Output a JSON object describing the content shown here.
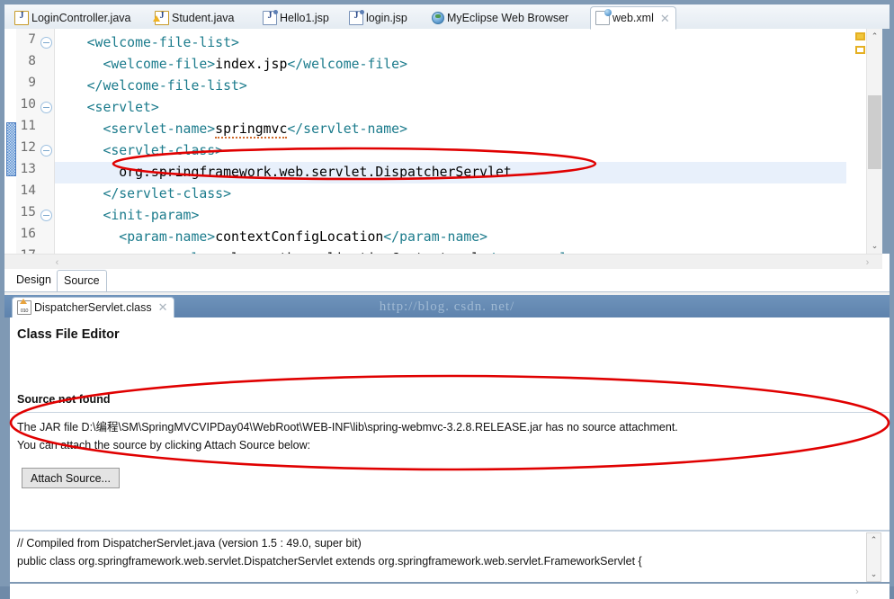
{
  "editor_tabs": [
    {
      "label": "LoginController.java",
      "icon": "java-file-icon",
      "active": false,
      "closable": false
    },
    {
      "label": "Student.java",
      "icon": "java-file-warning-icon",
      "active": false,
      "closable": false
    },
    {
      "label": "Hello1.jsp",
      "icon": "jsp-file-icon",
      "active": false,
      "closable": false
    },
    {
      "label": "login.jsp",
      "icon": "jsp-file-icon",
      "active": false,
      "closable": false
    },
    {
      "label": "MyEclipse Web Browser",
      "icon": "web-browser-icon",
      "active": false,
      "closable": false
    },
    {
      "label": "web.xml",
      "icon": "xml-file-icon",
      "active": true,
      "closable": true
    }
  ],
  "code": {
    "lines": [
      {
        "num": "7",
        "fold": true,
        "indent": 2,
        "segments": [
          {
            "t": "tag",
            "v": "<welcome-file-list>"
          }
        ]
      },
      {
        "num": "8",
        "fold": false,
        "indent": 3,
        "segments": [
          {
            "t": "tag",
            "v": "<welcome-file>"
          },
          {
            "t": "text",
            "v": "index.jsp"
          },
          {
            "t": "tag",
            "v": "</welcome-file>"
          }
        ]
      },
      {
        "num": "9",
        "fold": false,
        "indent": 2,
        "segments": [
          {
            "t": "tag",
            "v": "</welcome-file-list>"
          }
        ]
      },
      {
        "num": "10",
        "fold": true,
        "indent": 2,
        "segments": [
          {
            "t": "tag",
            "v": "<servlet>"
          }
        ]
      },
      {
        "num": "11",
        "fold": false,
        "indent": 3,
        "segments": [
          {
            "t": "tag",
            "v": "<servlet-name>"
          },
          {
            "t": "spell",
            "v": "springmvc"
          },
          {
            "t": "tag",
            "v": "</servlet-name>"
          }
        ]
      },
      {
        "num": "12",
        "fold": true,
        "indent": 3,
        "segments": [
          {
            "t": "tag",
            "v": "<servlet-class>"
          }
        ]
      },
      {
        "num": "13",
        "fold": false,
        "indent": 4,
        "highlight": true,
        "segments": [
          {
            "t": "text",
            "v": "org.springframework.web.servlet.DispatcherServlet"
          }
        ]
      },
      {
        "num": "14",
        "fold": false,
        "indent": 3,
        "segments": [
          {
            "t": "tag",
            "v": "</servlet-class>"
          }
        ]
      },
      {
        "num": "15",
        "fold": true,
        "indent": 3,
        "segments": [
          {
            "t": "tag",
            "v": "<init-param>"
          }
        ]
      },
      {
        "num": "16",
        "fold": false,
        "indent": 4,
        "segments": [
          {
            "t": "tag",
            "v": "<param-name>"
          },
          {
            "t": "text",
            "v": "contextConfigLocation"
          },
          {
            "t": "tag",
            "v": "</param-name>"
          }
        ]
      },
      {
        "num": "17",
        "fold": false,
        "indent": 4,
        "segments": [
          {
            "t": "tag",
            "v": "<param-value>"
          },
          {
            "t": "text",
            "v": "classpath:applicationContext.xml"
          },
          {
            "t": "tag",
            "v": "</param-value>"
          }
        ]
      }
    ]
  },
  "editor_footer_tabs": [
    {
      "label": "Design",
      "selected": true
    },
    {
      "label": "Source",
      "selected": false
    }
  ],
  "scroll": {
    "up_arrow": "⌃",
    "down_arrow": "⌄",
    "left_arrow": "‹",
    "right_arrow": "›"
  },
  "bottom_panel": {
    "tab": {
      "label": "DispatcherServlet.class",
      "icon": "class-file-icon",
      "closable": true
    },
    "watermark": "http://blog. csdn. net/",
    "title": "Class File Editor",
    "source_not_found": "Source not found",
    "message_line1": "The JAR file D:\\编程\\SM\\SpringMVCVIPDay04\\WebRoot\\WEB-INF\\lib\\spring-webmvc-3.2.8.RELEASE.jar has no source attachment.",
    "message_line2": "You can attach the source by clicking Attach Source below:",
    "attach_button": "Attach Source...",
    "code_line1": "// Compiled from DispatcherServlet.java (version 1.5 : 49.0, super bit)",
    "code_line2": "public class org.springframework.web.servlet.DispatcherServlet extends org.springframework.web.servlet.FrameworkServlet {"
  },
  "colors": {
    "frame": "#7f99b4",
    "xml_tag": "#1b7b8c",
    "highlight_line": "#e8f0fb",
    "annotation_red": "#e00000",
    "active_tab_bg": "#6f93bb"
  }
}
